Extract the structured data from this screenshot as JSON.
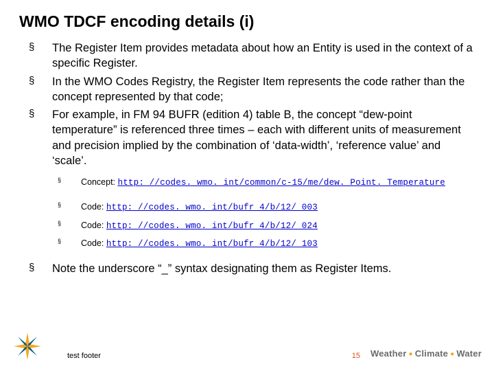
{
  "title": "WMO TDCF encoding details (i)",
  "bullets": [
    "The Register Item provides metadata about how an Entity is used in the context of a specific Register.",
    "In the WMO Codes Registry, the Register Item represents the code rather than the concept represented by that code;",
    "For example, in FM 94 BUFR (edition 4) table B, the concept “dew-point temperature” is referenced three times – each with different units of measurement and precision implied by the combination of ‘data-width’, ‘reference value’ and ‘scale’."
  ],
  "sub": {
    "concept": {
      "label": "Concept: ",
      "url": "http: //codes. wmo. int/common/c-15/me/dew. Point. Temperature"
    },
    "codes": [
      {
        "label": "Code: ",
        "url": "http: //codes. wmo. int/bufr 4/b/12/_003"
      },
      {
        "label": "Code: ",
        "url": "http: //codes. wmo. int/bufr 4/b/12/_024"
      },
      {
        "label": "Code: ",
        "url": "http: //codes. wmo. int/bufr 4/b/12/_103"
      }
    ]
  },
  "note": "Note the underscore “_” syntax designating them as Register Items.",
  "footer": {
    "text": "test footer",
    "page": "15",
    "brand": {
      "a": "Weather",
      "b": "Climate",
      "c": "Water"
    }
  },
  "glyph": "§"
}
